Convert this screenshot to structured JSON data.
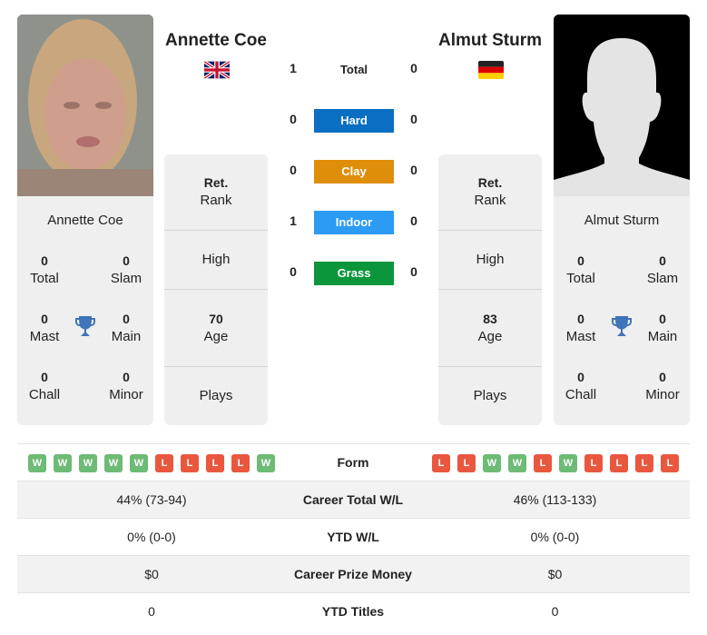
{
  "players": [
    {
      "name": "Annette Coe",
      "flag": "gb-flag",
      "photo": "player-photo",
      "titles": {
        "total": "0",
        "slam": "0",
        "mast": "0",
        "main": "0",
        "chall": "0",
        "minor": "0"
      },
      "rank": {
        "value": "Ret.",
        "label": "Rank"
      },
      "high": {
        "value": "",
        "label": "High"
      },
      "age": {
        "value": "70",
        "label": "Age"
      },
      "plays": {
        "value": "",
        "label": "Plays"
      },
      "form": [
        "W",
        "W",
        "W",
        "W",
        "W",
        "L",
        "L",
        "L",
        "L",
        "W"
      ],
      "career_total_wl": "44% (73-94)",
      "ytd_wl": "0% (0-0)",
      "career_prize_money": "$0",
      "ytd_titles": "0"
    },
    {
      "name": "Almut Sturm",
      "flag": "de-flag",
      "photo": "silhouette-placeholder",
      "titles": {
        "total": "0",
        "slam": "0",
        "mast": "0",
        "main": "0",
        "chall": "0",
        "minor": "0"
      },
      "rank": {
        "value": "Ret.",
        "label": "Rank"
      },
      "high": {
        "value": "",
        "label": "High"
      },
      "age": {
        "value": "83",
        "label": "Age"
      },
      "plays": {
        "value": "",
        "label": "Plays"
      },
      "form": [
        "L",
        "L",
        "W",
        "W",
        "L",
        "W",
        "L",
        "L",
        "L",
        "L"
      ],
      "career_total_wl": "46% (113-133)",
      "ytd_wl": "0% (0-0)",
      "career_prize_money": "$0",
      "ytd_titles": "0"
    }
  ],
  "title_labels": {
    "total": "Total",
    "slam": "Slam",
    "mast": "Mast",
    "main": "Main",
    "chall": "Chall",
    "minor": "Minor"
  },
  "h2h": {
    "total": {
      "label": "Total",
      "left": "1",
      "right": "0"
    },
    "surfaces": [
      {
        "label": "Hard",
        "left": "0",
        "right": "0",
        "color": "#0a6fc2"
      },
      {
        "label": "Clay",
        "left": "0",
        "right": "0",
        "color": "#df8e0a"
      },
      {
        "label": "Indoor",
        "left": "1",
        "right": "0",
        "color": "#2b9bf4"
      },
      {
        "label": "Grass",
        "left": "0",
        "right": "0",
        "color": "#0b963b"
      }
    ]
  },
  "table": {
    "form_label": "Form",
    "rows": [
      {
        "label": "Career Total W/L",
        "left": "44% (73-94)",
        "right": "46% (113-133)"
      },
      {
        "label": "YTD W/L",
        "left": "0% (0-0)",
        "right": "0% (0-0)"
      },
      {
        "label": "Career Prize Money",
        "left": "$0",
        "right": "$0"
      },
      {
        "label": "YTD Titles",
        "left": "0",
        "right": "0"
      }
    ]
  },
  "colors": {
    "win": "#6dbb75",
    "loss": "#e9573f",
    "trophy": "#3f74b8",
    "card_bg": "#efefef"
  }
}
